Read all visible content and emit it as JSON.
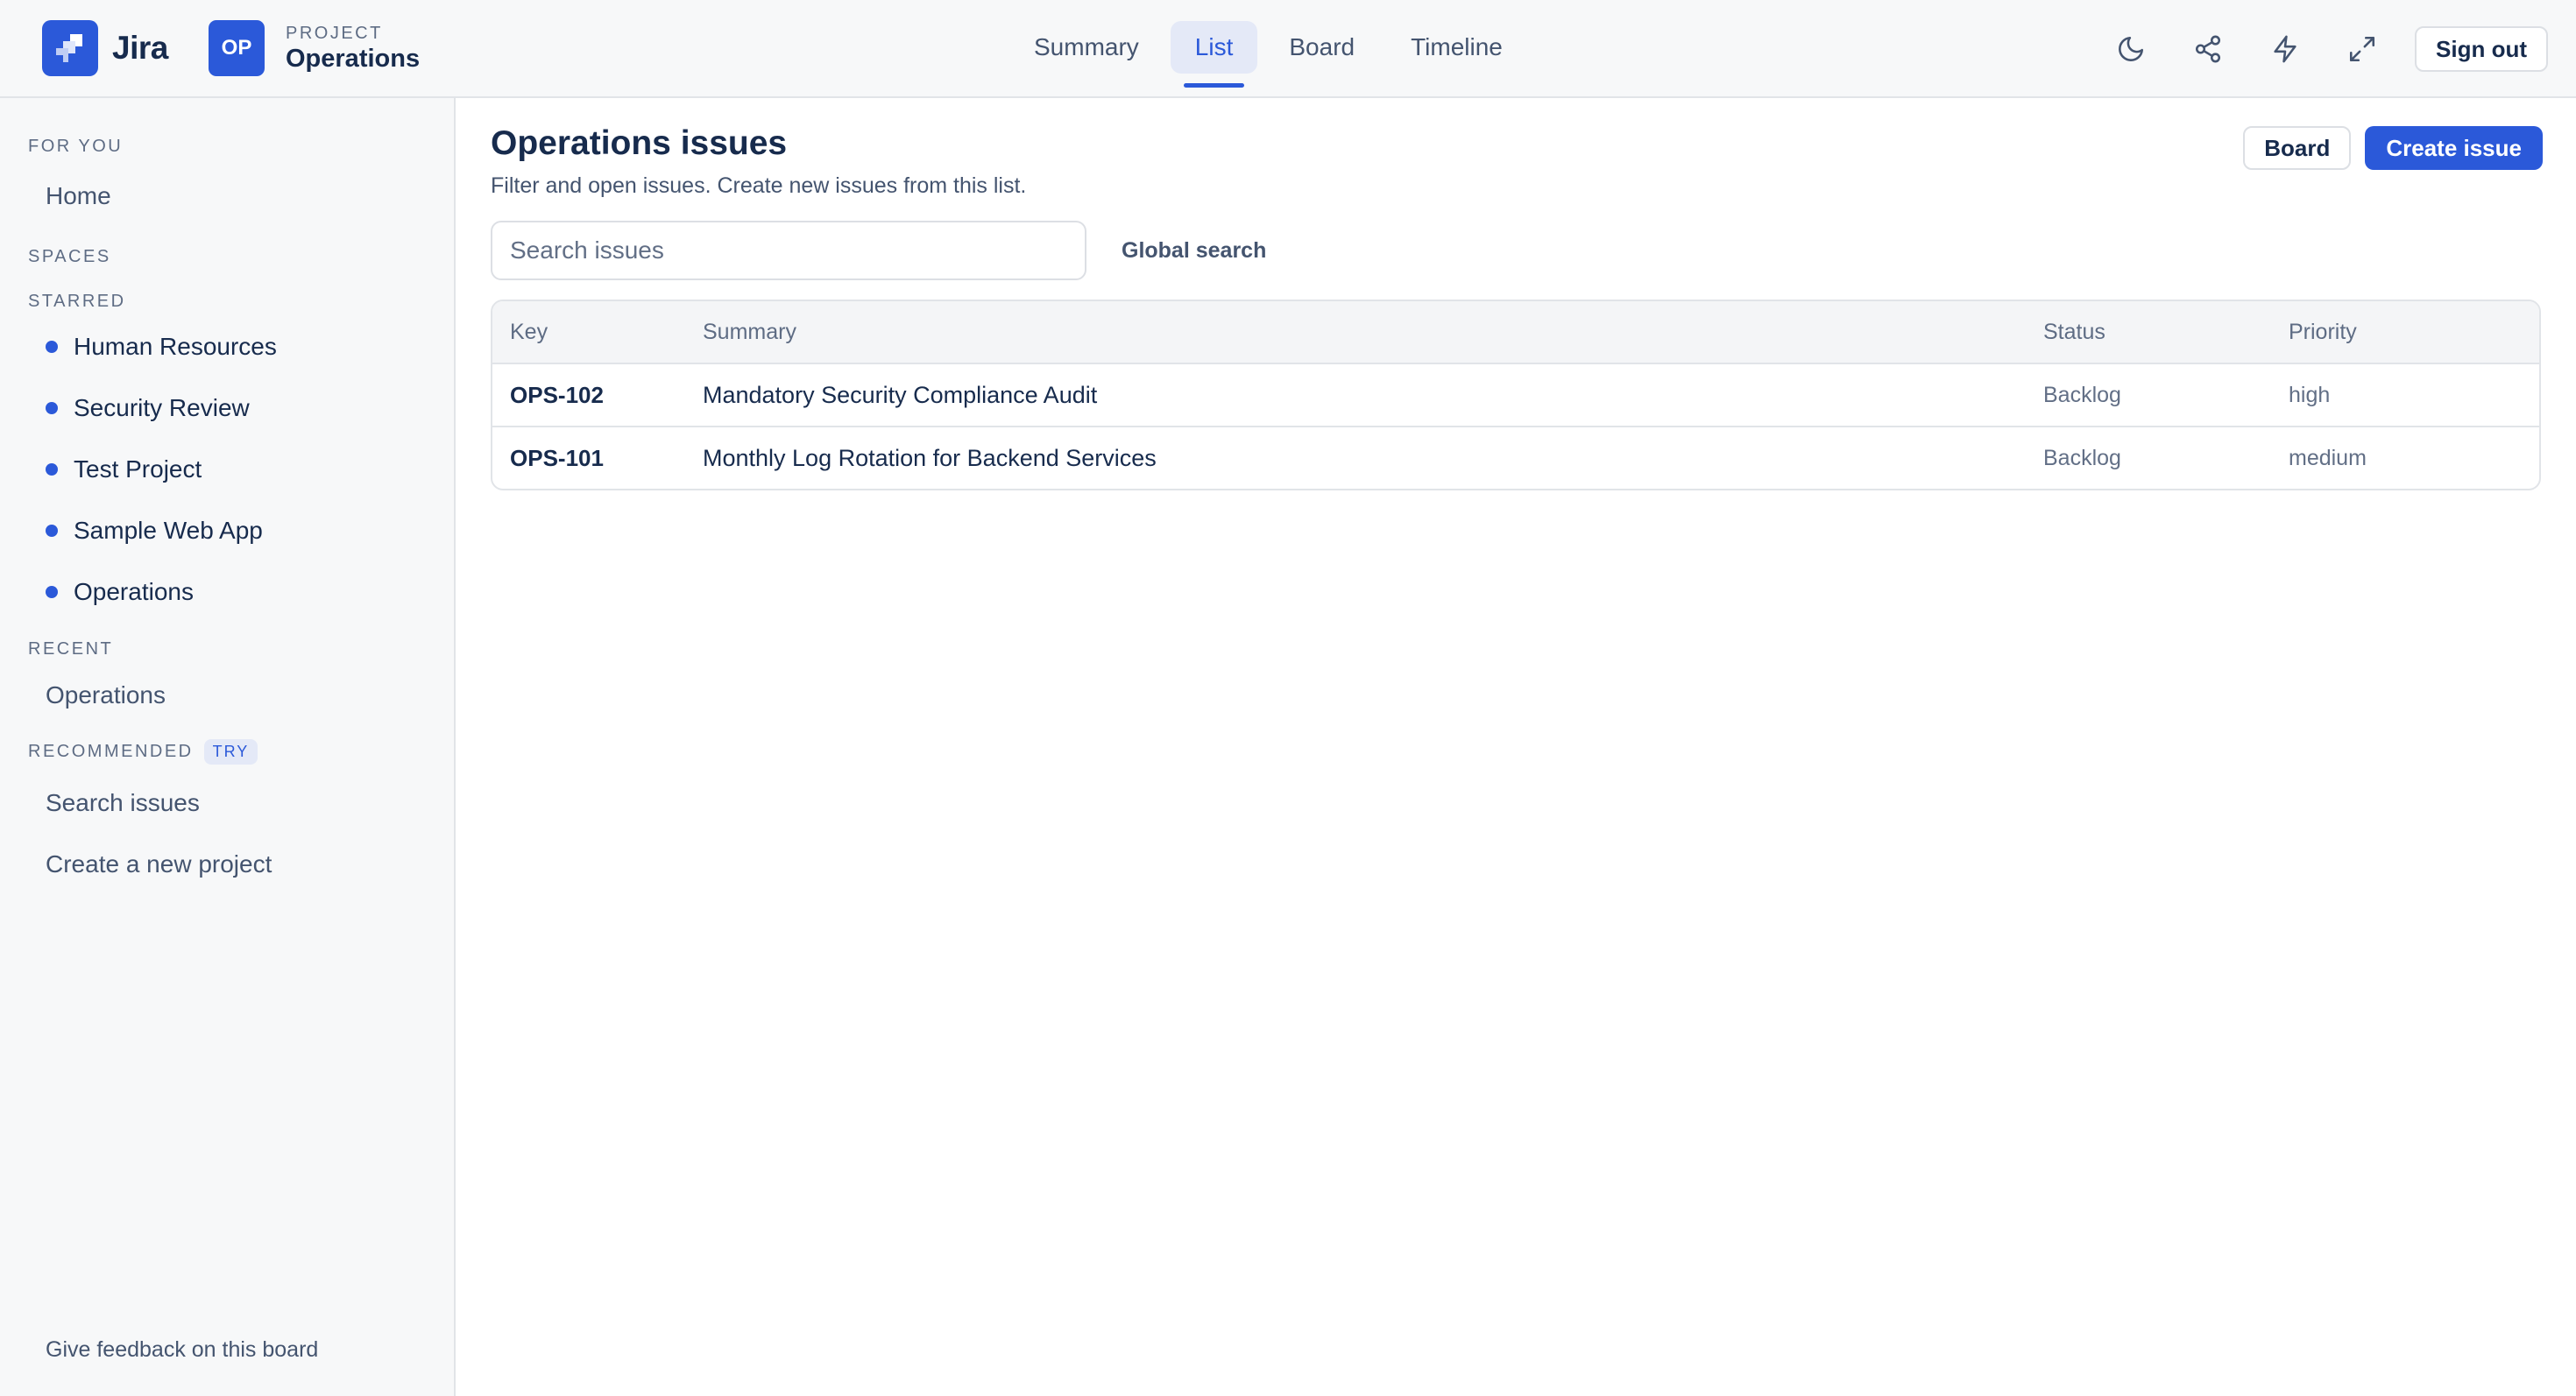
{
  "brand": {
    "name": "Jira",
    "logo_icon": "jira-logo-icon"
  },
  "project": {
    "avatar": "OP",
    "kicker": "PROJECT",
    "name": "Operations"
  },
  "tabs": [
    {
      "label": "Summary",
      "active": false
    },
    {
      "label": "List",
      "active": true
    },
    {
      "label": "Board",
      "active": false
    },
    {
      "label": "Timeline",
      "active": false
    }
  ],
  "actions": {
    "icons": [
      "moon-icon",
      "share-icon",
      "lightning-icon",
      "expand-icon"
    ],
    "signout_label": "Sign out"
  },
  "sidebar": {
    "for_you": "FOR YOU",
    "home": "Home",
    "spaces": "SPACES",
    "starred": "STARRED",
    "starred_items": [
      "Human Resources",
      "Security Review",
      "Test Project",
      "Sample Web App",
      "Operations"
    ],
    "recent": "RECENT",
    "recent_items": [
      "Operations"
    ],
    "recommended": "RECOMMENDED",
    "try_badge": "TRY",
    "recommended_items": [
      "Search issues",
      "Create a new project"
    ],
    "feedback": "Give feedback on this board"
  },
  "main": {
    "title": "Operations issues",
    "subtitle": "Filter and open issues. Create new issues from this list.",
    "board_button": "Board",
    "create_button": "Create issue",
    "search_placeholder": "Search issues",
    "global_search": "Global search"
  },
  "table": {
    "columns": {
      "key": "Key",
      "summary": "Summary",
      "status": "Status",
      "priority": "Priority"
    },
    "rows": [
      {
        "key": "OPS-102",
        "summary": "Mandatory Security Compliance Audit",
        "status": "Backlog",
        "priority": "high"
      },
      {
        "key": "OPS-101",
        "summary": "Monthly Log Rotation for Backend Services",
        "status": "Backlog",
        "priority": "medium"
      }
    ]
  },
  "colors": {
    "accent": "#2b59d9",
    "sidebar_bg": "#f7f8f9",
    "text": "#172b4d",
    "muted": "#44546f"
  }
}
